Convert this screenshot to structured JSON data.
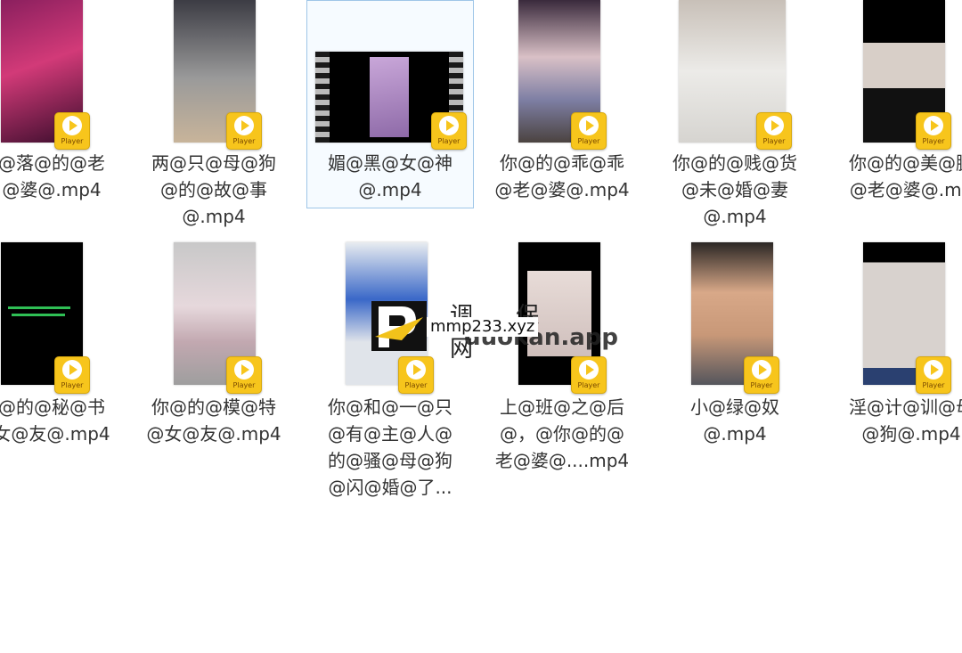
{
  "badge_label": "Player",
  "files": [
    {
      "lines": [
        "@落@的@老",
        "@婆@.mp4"
      ]
    },
    {
      "lines": [
        "两@只@母@狗",
        "@的@故@事",
        "@.mp4"
      ]
    },
    {
      "lines": [
        "媚@黑@女@神",
        "@.mp4"
      ],
      "selected": true
    },
    {
      "lines": [
        "你@的@乖@乖",
        "@老@婆@.mp4"
      ]
    },
    {
      "lines": [
        "你@的@贱@货",
        "@未@婚@妻",
        "@.mp4"
      ]
    },
    {
      "lines": [
        "你@的@美@腿",
        "@老@婆@.mp"
      ]
    },
    {
      "lines": [
        "@的@秘@书",
        "女@友@.mp4"
      ]
    },
    {
      "lines": [
        "你@的@模@特",
        "@女@友@.mp4"
      ]
    },
    {
      "lines": [
        "你@和@一@只",
        "@有@主@人@",
        "的@骚@母@狗",
        "@闪@婚@了..."
      ]
    },
    {
      "lines": [
        "上@班@之@后",
        "@，@你@的@",
        "老@婆@....mp4"
      ]
    },
    {
      "lines": [
        "小@绿@奴",
        "@.mp4"
      ]
    },
    {
      "lines": [
        "淫@计@训@母",
        "@狗@.mp4"
      ]
    }
  ],
  "watermark": {
    "url_text": "mmp233.xyz",
    "chinese_text": "调 保 网",
    "app_text": "duokan.app"
  }
}
